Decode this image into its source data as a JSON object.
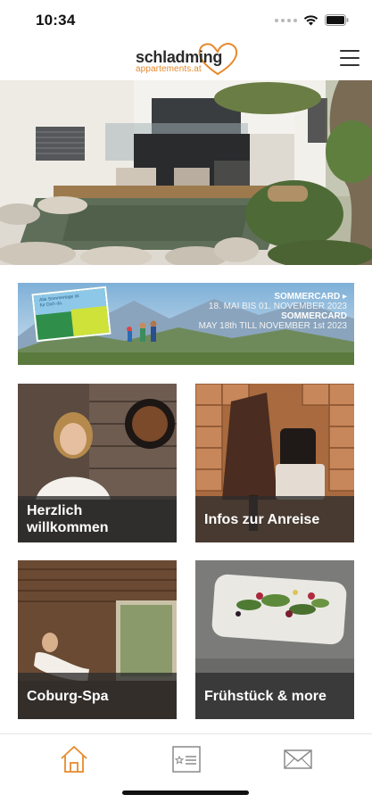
{
  "status_bar": {
    "time": "10:34"
  },
  "header": {
    "logo_main": "schladming",
    "logo_sub": "appartements.at",
    "brand_color": "#e78a2c"
  },
  "banner": {
    "title_de": "SOMMERCARD ▸",
    "date_de": "18. MAI BIS 01. NOVEMBER 2023",
    "title_en": "SOMMERCARD",
    "date_en": "MAY 18th TILL NOVEMBER 1st 2023",
    "card_text": "Alle Sommertage ist für Dich da."
  },
  "tiles": [
    {
      "label": "Herzlich willkommen"
    },
    {
      "label": "Infos zur Anreise"
    },
    {
      "label": "Coburg-Spa"
    },
    {
      "label": "Frühstück & more"
    }
  ],
  "tab_bar": {
    "items": [
      {
        "icon": "home-icon",
        "active": true
      },
      {
        "icon": "card-icon",
        "active": false
      },
      {
        "icon": "mail-icon",
        "active": false
      }
    ],
    "active_color": "#e78a2c",
    "inactive_color": "#8a8a8a"
  }
}
